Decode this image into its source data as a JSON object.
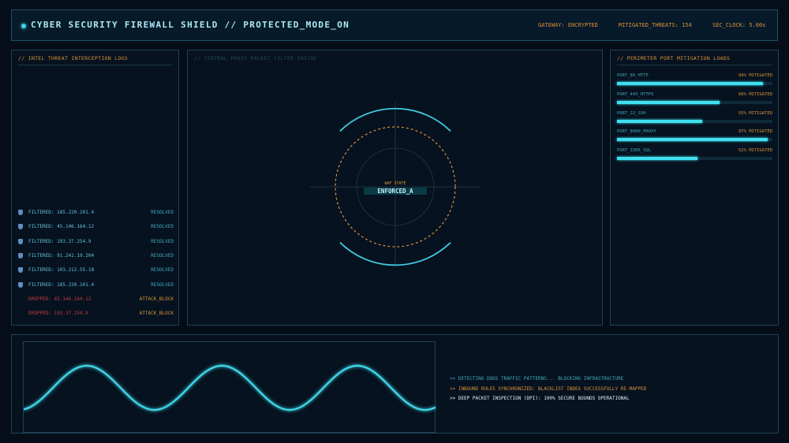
{
  "header": {
    "title": "CYBER SECURITY FIREWALL SHIELD // PROTECTED_MODE_ON",
    "gateway": "GATEWAY: ENCRYPTED",
    "mitigated": "MITIGATED_THREATS: 154",
    "clock": "SEC_CLOCK: 5.00s"
  },
  "left_panel": {
    "title": "// INTEL THREAT INTERCEPTION LOGS",
    "logs": [
      {
        "ip": "FILTERED: 185.220.101.4",
        "status": "RESOLVED",
        "kind": "filtered"
      },
      {
        "ip": "FILTERED: 45.146.164.12",
        "status": "RESOLVED",
        "kind": "filtered"
      },
      {
        "ip": "FILTERED: 193.37.254.9",
        "status": "RESOLVED",
        "kind": "filtered"
      },
      {
        "ip": "FILTERED: 91.241.19.204",
        "status": "RESOLVED",
        "kind": "filtered"
      },
      {
        "ip": "FILTERED: 103.212.55.18",
        "status": "RESOLVED",
        "kind": "filtered"
      },
      {
        "ip": "FILTERED: 185.220.101.4",
        "status": "RESOLVED",
        "kind": "filtered"
      },
      {
        "ip": "DROPPED: 45.146.164.12",
        "status": "ATTACK_BLOCK",
        "kind": "dropped"
      },
      {
        "ip": "DROPPED: 193.37.254.9",
        "status": "ATTACK_BLOCK",
        "kind": "dropped"
      }
    ]
  },
  "center_panel": {
    "title": "// CENTRAL PROXY PACKET FILTER ENGINE",
    "waf_label": "WAF STATE",
    "waf_value": "ENFORCED_A"
  },
  "right_panel": {
    "title": "// PERIMETER PORT MITIGATION LOADS",
    "ports": [
      {
        "name": "PORT_80_HTTP",
        "percent_label": "94% MITIGATED",
        "value": 94
      },
      {
        "name": "PORT_443_HTTPS",
        "percent_label": "66% MITIGATED",
        "value": 66
      },
      {
        "name": "PORT_22_SSH",
        "percent_label": "55% MITIGATED",
        "value": 55
      },
      {
        "name": "PORT_8080_PROXY",
        "percent_label": "97% MITIGATED",
        "value": 97
      },
      {
        "name": "PORT_3306_SQL",
        "percent_label": "52% MITIGATED",
        "value": 52
      }
    ]
  },
  "console": {
    "lines": [
      {
        "text": ">> DETECTING DDOS TRAFFIC PATTERNS... BLOCKING INFRASTRUCTURE",
        "color": "#3fa9bd"
      },
      {
        "text": ">> INBOUND RULES SYNCHRONIZED: BLACKLIST INDEX SUCCESSFULLY RE-MAPPED",
        "color": "#d8923a"
      },
      {
        "text": ">> DEEP PACKET INSPECTION (DPI): 100% SECURE BOUNDS OPERATIONAL",
        "color": "#e3eef2"
      }
    ]
  },
  "colors": {
    "accent": "#40e0ef",
    "warning": "#d8923a",
    "danger": "#c33a3a"
  }
}
